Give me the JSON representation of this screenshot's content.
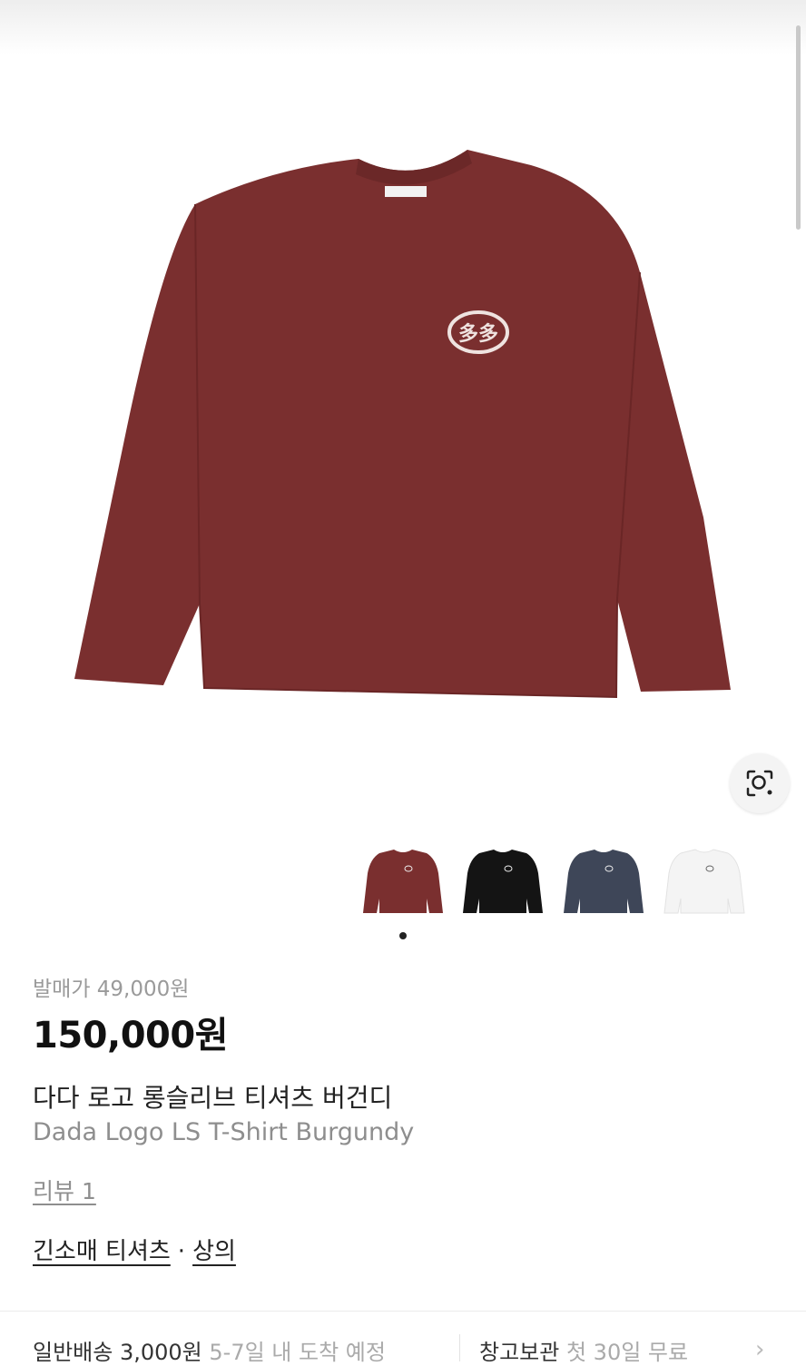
{
  "product": {
    "release_price": "발매가 49,000원",
    "price": "150,000원",
    "name_ko": "다다 로고 롱슬리브 티셔츠 버건디",
    "name_en": "Dada Logo LS T-Shirt Burgundy",
    "review": "리뷰 1",
    "category_1": "긴소매 티셔츠",
    "category_sep": "·",
    "category_2": "상의",
    "main_image_color": "#7a2f2f"
  },
  "thumbnails": [
    {
      "color": "#7a2f2f",
      "label": "burgundy"
    },
    {
      "color": "#141414",
      "label": "black"
    },
    {
      "color": "#3e4658",
      "label": "navy"
    },
    {
      "color": "#f4f4f4",
      "label": "white"
    }
  ],
  "shipping": {
    "text": "일반배송 3,000원",
    "detail": "5-7일 내 도착 예정",
    "inspect": "창고보관",
    "inspect_detail": "첫 30일 무료"
  },
  "icons": {
    "lens": "lens-search-icon",
    "chevron": "chevron-right-icon"
  }
}
